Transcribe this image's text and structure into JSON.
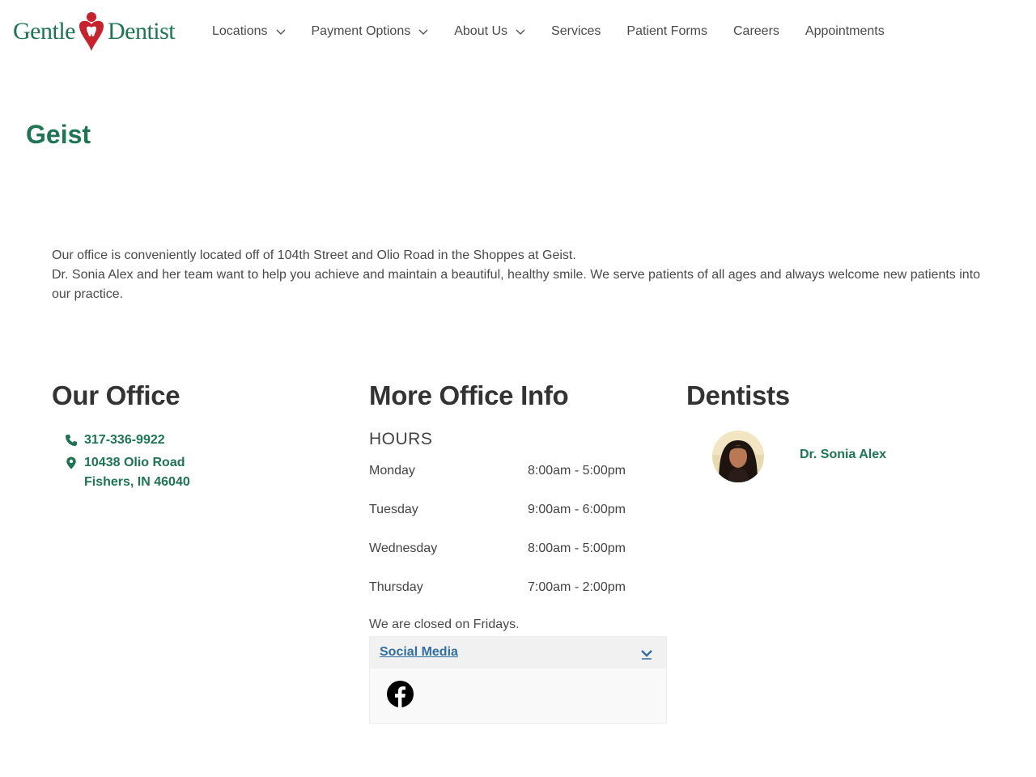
{
  "brand": {
    "logo_left": "Gentle",
    "logo_right": "Dentist",
    "green": "#1d7553",
    "red": "#c8232c"
  },
  "nav": {
    "items": [
      {
        "label": "Locations",
        "has_dropdown": true
      },
      {
        "label": "Payment Options",
        "has_dropdown": true
      },
      {
        "label": "About Us",
        "has_dropdown": true
      },
      {
        "label": "Services",
        "has_dropdown": false
      },
      {
        "label": "Patient Forms",
        "has_dropdown": false
      },
      {
        "label": "Careers",
        "has_dropdown": false
      },
      {
        "label": "Appointments",
        "has_dropdown": false
      }
    ]
  },
  "page": {
    "title": "Geist",
    "intro_line1": "Our office is conveniently located off of 104th Street and Olio Road in the Shoppes at Geist.",
    "intro_line2": "Dr. Sonia Alex and her team want to help you achieve and maintain a beautiful, healthy smile. We serve patients of all ages and always welcome new patients into our practice."
  },
  "office": {
    "heading": "Our Office",
    "phone": "317-336-9922",
    "phone_icon": "phone-icon",
    "address_line1": "10438 Olio Road",
    "address_line2": "Fishers, IN 46040",
    "address_icon": "map-pin-icon"
  },
  "more_info": {
    "heading": "More Office Info",
    "hours_heading": "HOURS",
    "hours": [
      {
        "day": "Monday",
        "time": "8:00am - 5:00pm"
      },
      {
        "day": "Tuesday",
        "time": "9:00am - 6:00pm"
      },
      {
        "day": "Wednesday",
        "time": "8:00am - 5:00pm"
      },
      {
        "day": "Thursday",
        "time": "7:00am - 2:00pm"
      }
    ],
    "closed_note": "We are closed on Fridays.",
    "social_title": "Social Media",
    "social_icon": "facebook-icon"
  },
  "dentists": {
    "heading": "Dentists",
    "items": [
      {
        "name": "Dr. Sonia Alex"
      }
    ]
  }
}
